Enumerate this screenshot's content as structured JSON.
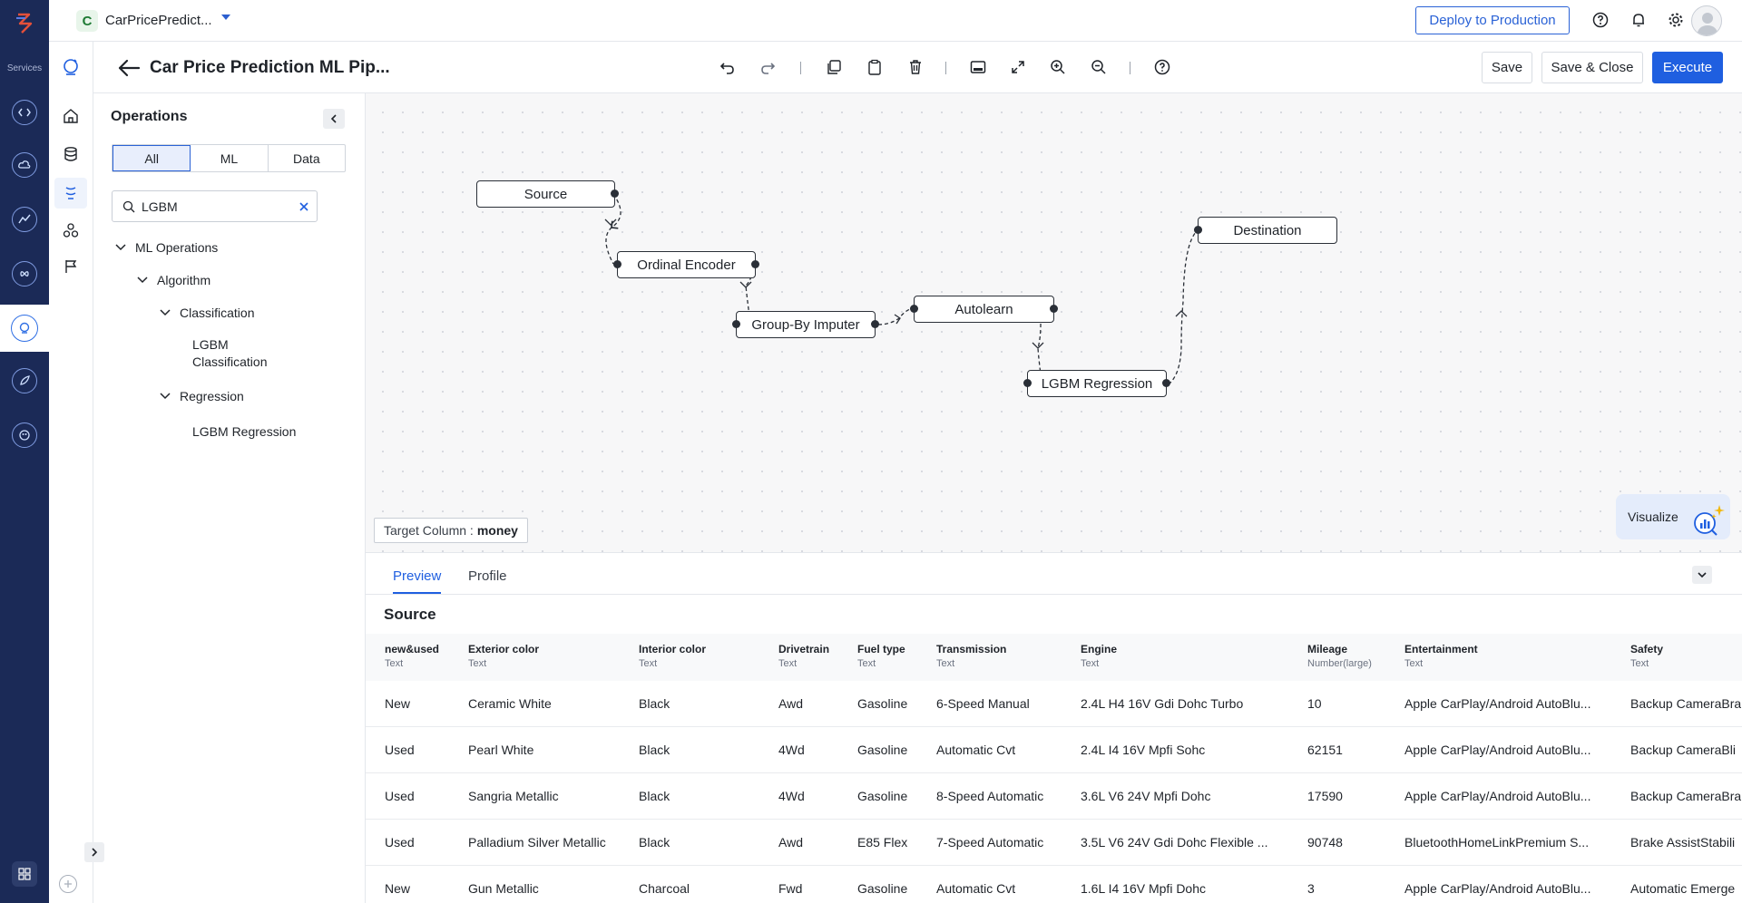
{
  "rail": {
    "services_label": "Services"
  },
  "topbar": {
    "project_initial": "C",
    "project_name": "CarPricePredict...",
    "deploy_label": "Deploy to Production"
  },
  "header": {
    "title": "Car Price Prediction ML Pip...",
    "save_label": "Save",
    "save_close_label": "Save & Close",
    "execute_label": "Execute"
  },
  "operations": {
    "title": "Operations",
    "filters": [
      "All",
      "ML",
      "Data"
    ],
    "active_filter": "All",
    "search_value": "LGBM",
    "tree": {
      "ml_operations": "ML Operations",
      "algorithm": "Algorithm",
      "classification": "Classification",
      "lgbm_classification_line1": "LGBM",
      "lgbm_classification_line2": "Classification",
      "regression": "Regression",
      "lgbm_regression": "LGBM Regression"
    }
  },
  "canvas": {
    "nodes": {
      "source": "Source",
      "ordinal_encoder": "Ordinal Encoder",
      "group_by_imputer": "Group-By Imputer",
      "autolearn": "Autolearn",
      "lgbm_regression": "LGBM Regression",
      "destination": "Destination"
    },
    "target_label": "Target Column :",
    "target_value": "money",
    "visualize_label": "Visualize"
  },
  "preview": {
    "tabs": [
      "Preview",
      "Profile"
    ],
    "active_tab": "Preview",
    "section_title": "Source",
    "columns": [
      {
        "name": "new&used",
        "type": "Text"
      },
      {
        "name": "Exterior color",
        "type": "Text"
      },
      {
        "name": "Interior color",
        "type": "Text"
      },
      {
        "name": "Drivetrain",
        "type": "Text"
      },
      {
        "name": "Fuel type",
        "type": "Text"
      },
      {
        "name": "Transmission",
        "type": "Text"
      },
      {
        "name": "Engine",
        "type": "Text"
      },
      {
        "name": "Mileage",
        "type": "Number(large)"
      },
      {
        "name": "Entertainment",
        "type": "Text"
      },
      {
        "name": "Safety",
        "type": "Text"
      }
    ],
    "rows": [
      [
        "New",
        "Ceramic White",
        "Black",
        "Awd",
        "Gasoline",
        "6-Speed Manual",
        "2.4L H4 16V Gdi Dohc Turbo",
        "10",
        "Apple CarPlay/Android AutoBlu...",
        "Backup CameraBra"
      ],
      [
        "Used",
        "Pearl White",
        "Black",
        "4Wd",
        "Gasoline",
        "Automatic Cvt",
        "2.4L I4 16V Mpfi Sohc",
        "62151",
        "Apple CarPlay/Android AutoBlu...",
        "Backup CameraBli"
      ],
      [
        "Used",
        "Sangria Metallic",
        "Black",
        "4Wd",
        "Gasoline",
        "8-Speed Automatic",
        "3.6L V6 24V Mpfi Dohc",
        "17590",
        "Apple CarPlay/Android AutoBlu...",
        "Backup CameraBra"
      ],
      [
        "Used",
        "Palladium Silver Metallic",
        "Black",
        "Awd",
        "E85 Flex",
        "7-Speed Automatic",
        "3.5L V6 24V Gdi Dohc Flexible ...",
        "90748",
        "BluetoothHomeLinkPremium S...",
        "Brake AssistStabili"
      ],
      [
        "New",
        "Gun Metallic",
        "Charcoal",
        "Fwd",
        "Gasoline",
        "Automatic Cvt",
        "1.6L I4 16V Mpfi Dohc",
        "3",
        "Apple CarPlay/Android AutoBlu...",
        "Automatic Emerge"
      ]
    ]
  },
  "colors": {
    "rail": "#1b2a57",
    "accent": "#1f5fe0"
  }
}
